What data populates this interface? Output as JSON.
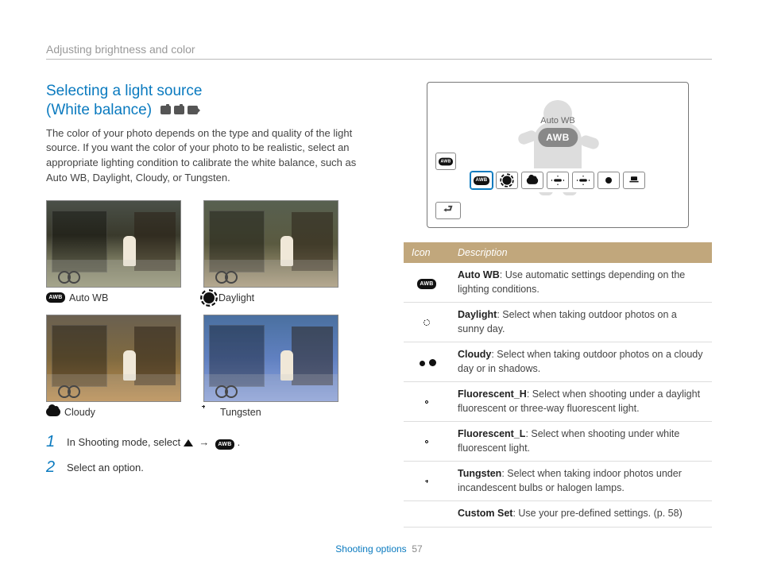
{
  "breadcrumb": "Adjusting brightness and color",
  "heading_line1": "Selecting a light source",
  "heading_line2": "(White balance)",
  "intro": "The color of your photo depends on the type and quality of the light source. If you want the color of your photo to be realistic, select an appropriate lighting condition to calibrate the white balance, such as Auto WB, Daylight, Cloudy, or Tungsten.",
  "samples": [
    {
      "label": "Auto WB",
      "icon": "awb"
    },
    {
      "label": "Daylight",
      "icon": "sun"
    },
    {
      "label": "Cloudy",
      "icon": "cloud"
    },
    {
      "label": "Tungsten",
      "icon": "bulb"
    }
  ],
  "steps": {
    "s1_num": "1",
    "s1_a": "In Shooting mode, select ",
    "s1_arrow": " → ",
    "s1_c": ".",
    "s2_num": "2",
    "s2_text": "Select an option."
  },
  "lcd": {
    "badge_title": "Auto WB",
    "badge_text": "AWB",
    "options": [
      "awb",
      "sun",
      "cloud",
      "fluor",
      "fluor",
      "bulb",
      "custom"
    ],
    "selected": 0
  },
  "table": {
    "head_icon": "Icon",
    "head_desc": "Description",
    "rows": [
      {
        "icon": "awb",
        "term": "Auto WB",
        "desc": ": Use automatic settings depending on the lighting conditions."
      },
      {
        "icon": "sun",
        "term": "Daylight",
        "desc": ": Select when taking outdoor photos on a sunny day."
      },
      {
        "icon": "cloud",
        "term": "Cloudy",
        "desc": ": Select when taking outdoor photos on a cloudy day or in shadows."
      },
      {
        "icon": "fluor",
        "term": "Fluorescent_H",
        "desc": ": Select when shooting under a daylight fluorescent or three-way fluorescent light."
      },
      {
        "icon": "fluor",
        "term": "Fluorescent_L",
        "desc": ": Select when shooting under white fluorescent light."
      },
      {
        "icon": "bulb",
        "term": "Tungsten",
        "desc": ": Select when taking indoor photos under incandescent bulbs or halogen lamps."
      },
      {
        "icon": "custom",
        "term": "Custom Set",
        "desc": ": Use your pre-defined settings. (p. 58)"
      }
    ]
  },
  "footer": {
    "section": "Shooting options",
    "page": "57"
  },
  "awb_chip": "AWB"
}
